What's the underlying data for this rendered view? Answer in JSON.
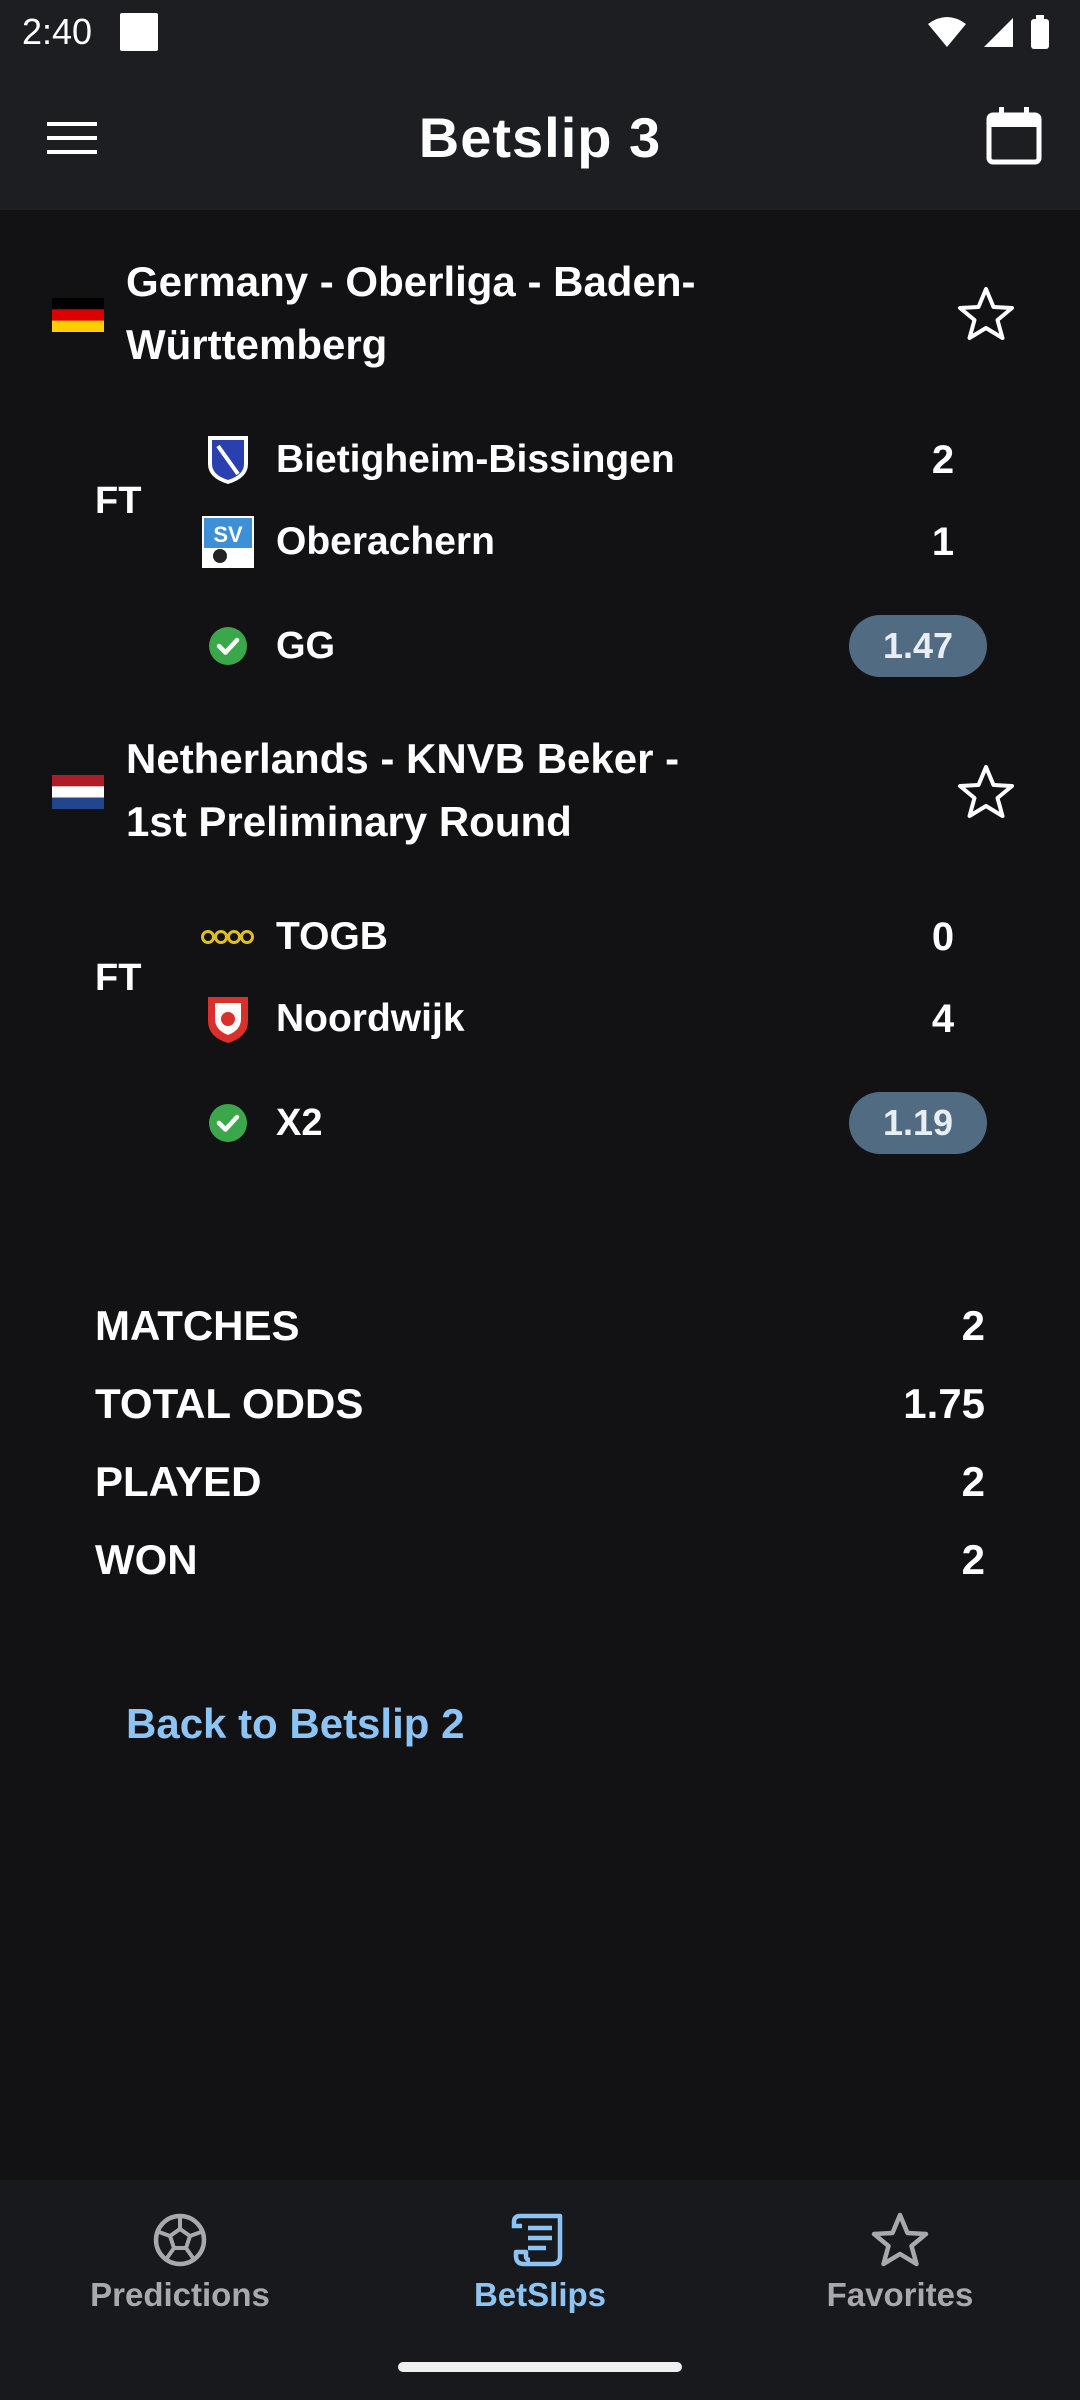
{
  "status_bar": {
    "time": "2:40"
  },
  "app_bar": {
    "title": "Betslip 3"
  },
  "leagues": [
    {
      "name": "Germany - Oberliga - Baden-Württemberg",
      "status": "FT",
      "home": {
        "name": "Bietigheim-Bissingen",
        "score": "2"
      },
      "away": {
        "name": "Oberachern",
        "score": "1"
      },
      "pick": {
        "label": "GG",
        "odds": "1.47"
      }
    },
    {
      "name": "Netherlands - KNVB Beker - 1st Preliminary Round",
      "status": "FT",
      "home": {
        "name": "TOGB",
        "score": "0"
      },
      "away": {
        "name": "Noordwijk",
        "score": "4"
      },
      "pick": {
        "label": "X2",
        "odds": "1.19"
      }
    }
  ],
  "summary": {
    "matches_label": "MATCHES",
    "matches_value": "2",
    "total_odds_label": "TOTAL ODDS",
    "total_odds_value": "1.75",
    "played_label": "PLAYED",
    "played_value": "2",
    "won_label": "WON",
    "won_value": "2"
  },
  "back_link": "Back to Betslip 2",
  "nav": {
    "predictions": "Predictions",
    "betslips": "BetSlips",
    "favorites": "Favorites"
  },
  "colors": {
    "background": "#121215",
    "bar": "#1d1e21",
    "accent": "#8cc4f5",
    "odds_badge": "#506b82",
    "success": "#3aa84a"
  }
}
